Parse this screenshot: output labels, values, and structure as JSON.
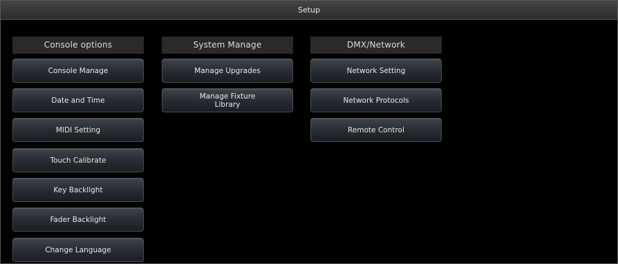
{
  "window": {
    "title": "Setup"
  },
  "columns": {
    "console_options": {
      "header": "Console options",
      "buttons": [
        "Console Manage",
        "Date and Time",
        "MIDI Setting",
        "Touch Calibrate",
        "Key Backlight",
        "Fader Backlight",
        "Change Language"
      ]
    },
    "system_manage": {
      "header": "System Manage",
      "buttons": [
        "Manage Upgrades",
        "Manage Fixture\nLibrary"
      ]
    },
    "dmx_network": {
      "header": "DMX/Network",
      "buttons": [
        "Network Setting",
        "Network Protocols",
        "Remote Control"
      ]
    }
  },
  "colors": {
    "background": "#000000",
    "titlebar": "#3a3a3a",
    "column_header": "#2a2a2a",
    "button_top": "#3f444c",
    "button_bottom": "#1b1e23",
    "text": "#e8e8e8"
  }
}
